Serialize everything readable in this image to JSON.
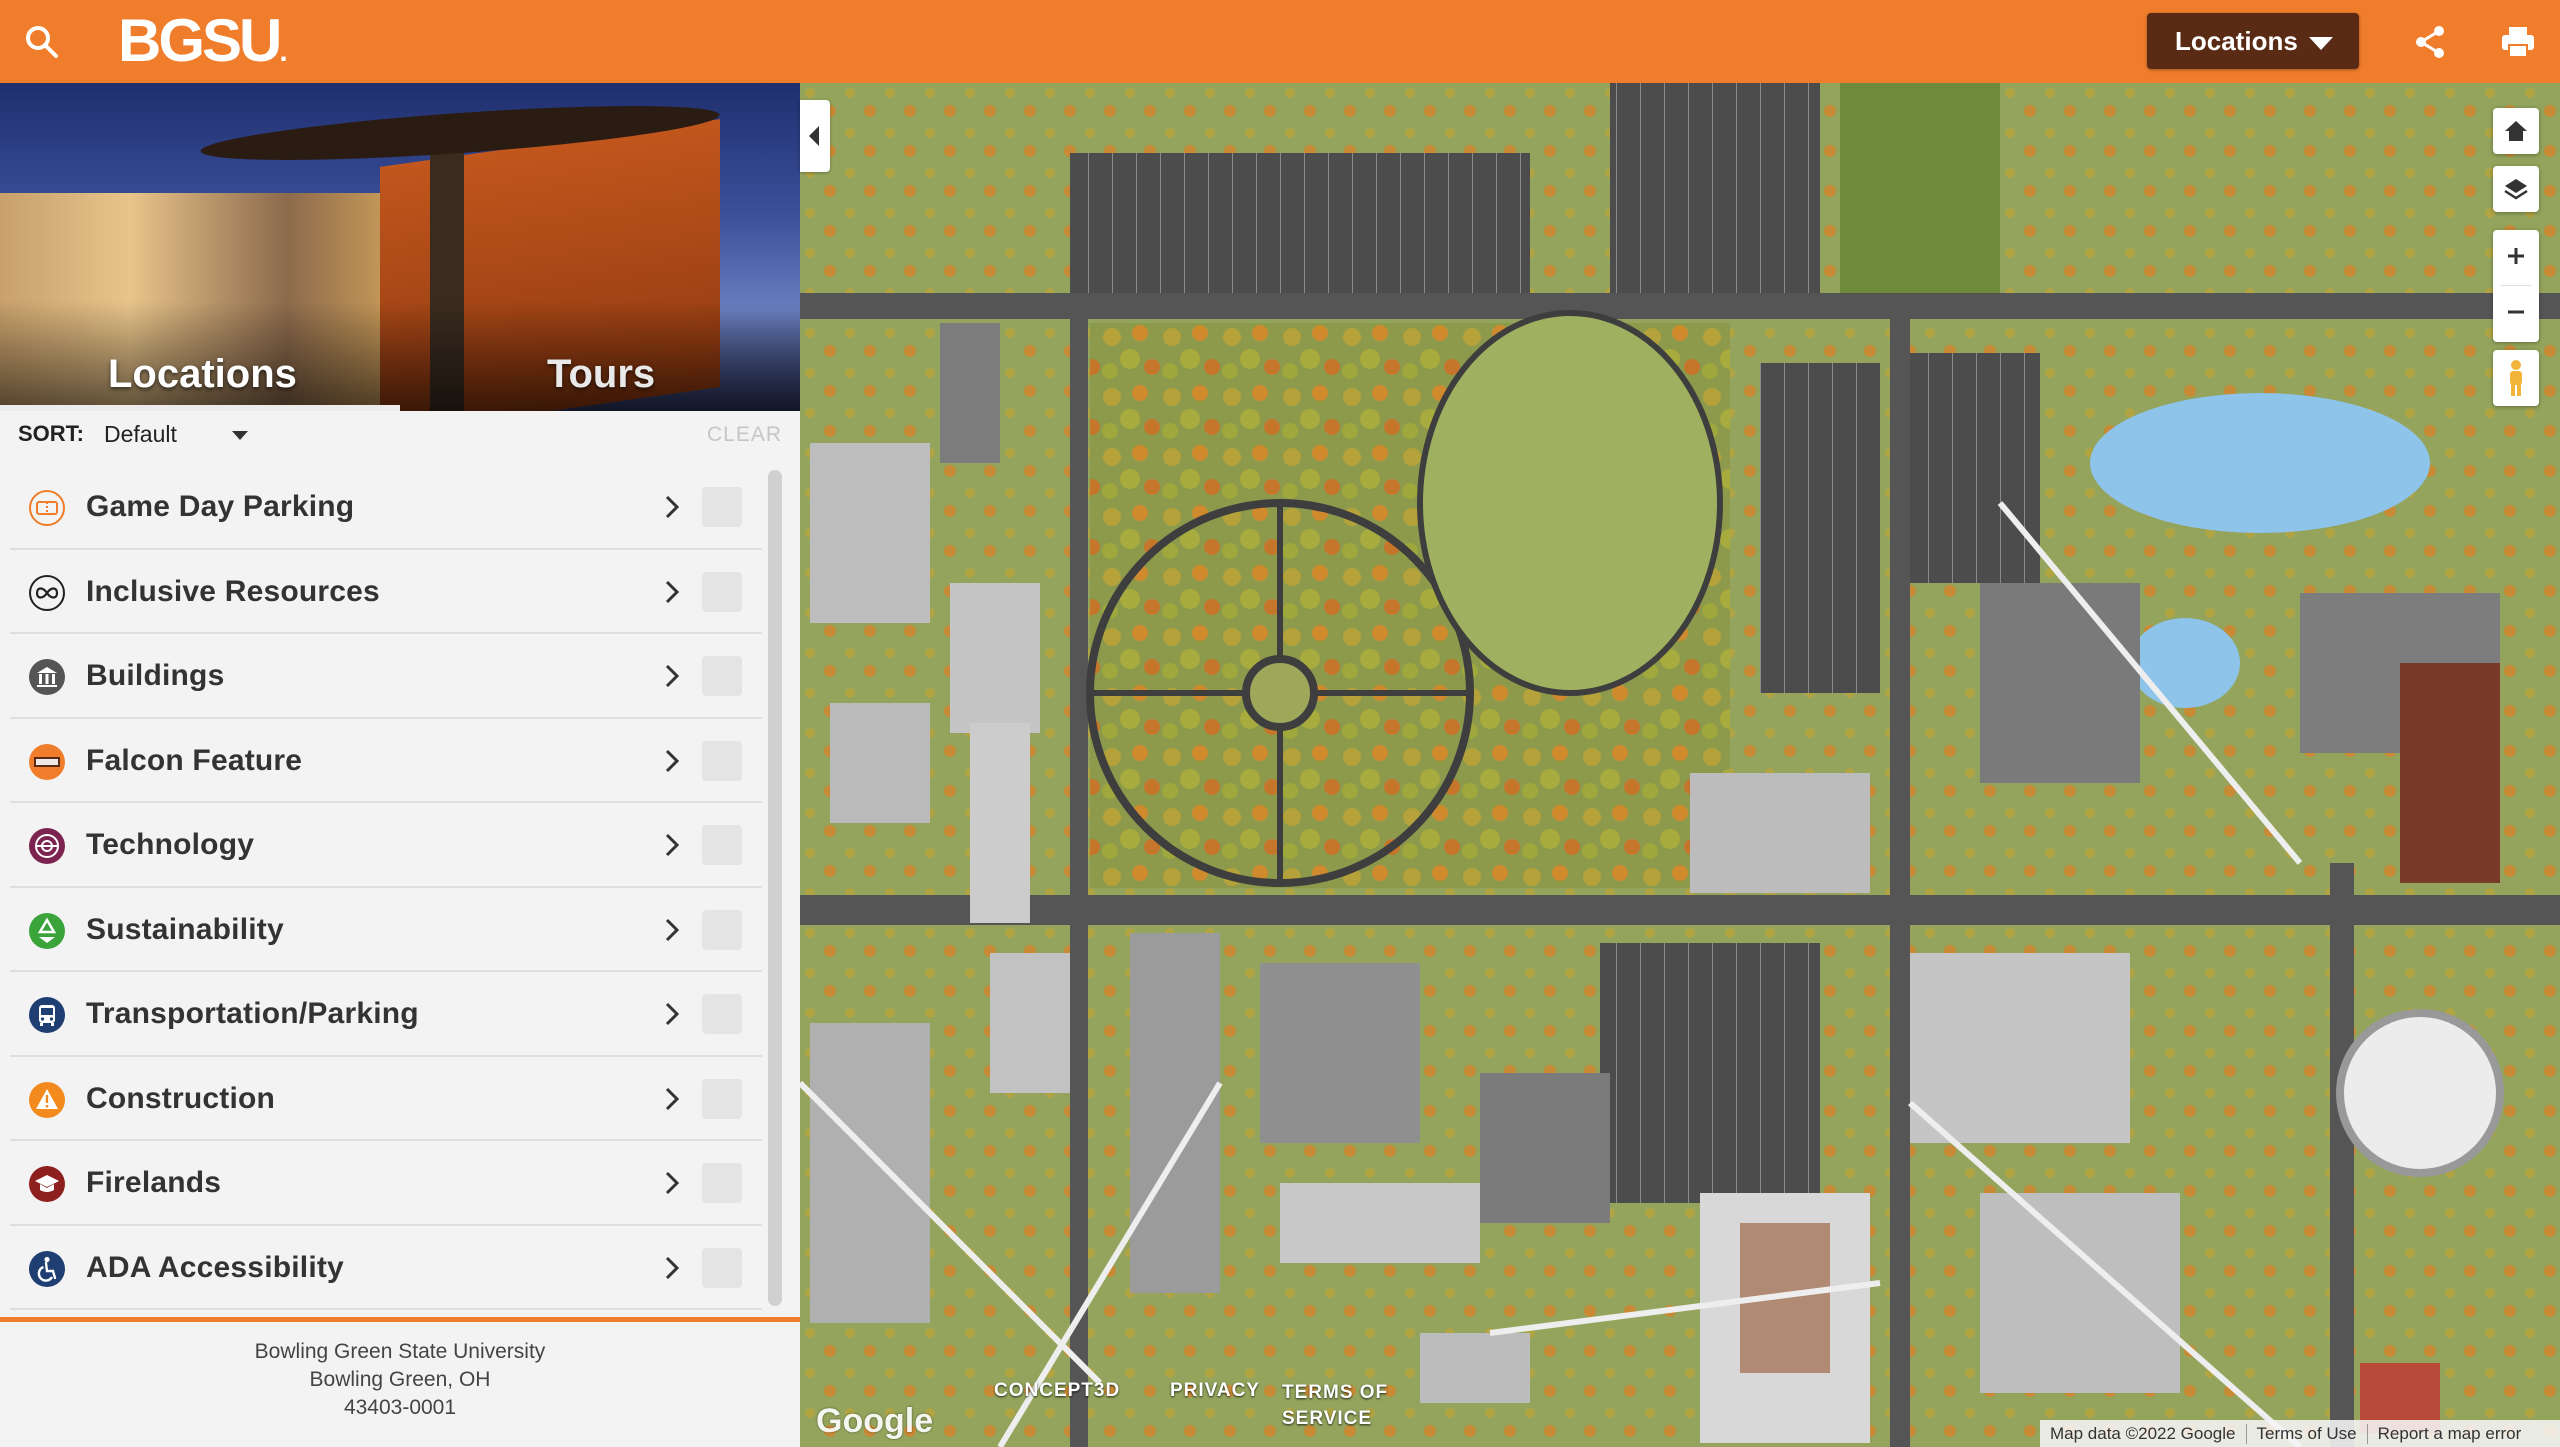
{
  "header": {
    "logo_text": "BGSU",
    "logo_dot": ".",
    "locations_button": "Locations",
    "brand_color": "#f07d2b",
    "button_color": "#5a2b14"
  },
  "hero": {
    "tabs": [
      {
        "label": "Locations",
        "active": true
      },
      {
        "label": "Tours",
        "active": false
      }
    ]
  },
  "sort": {
    "label": "SORT:",
    "value": "Default",
    "clear": "CLEAR"
  },
  "categories": [
    {
      "label": "Game Day Parking",
      "icon": "ticket-icon",
      "color": "#f07d2b"
    },
    {
      "label": "Inclusive Resources",
      "icon": "infinity-icon",
      "color": "#222222"
    },
    {
      "label": "Buildings",
      "icon": "building-icon",
      "color": "#555555"
    },
    {
      "label": "Falcon Feature",
      "icon": "bgsu-badge-icon",
      "color": "#f07d2b"
    },
    {
      "label": "Technology",
      "icon": "technology-icon",
      "color": "#7d2350"
    },
    {
      "label": "Sustainability",
      "icon": "recycle-icon",
      "color": "#3aa43a"
    },
    {
      "label": "Transportation/Parking",
      "icon": "bus-icon",
      "color": "#1f3e72"
    },
    {
      "label": "Construction",
      "icon": "warning-icon",
      "color": "#f28a1d"
    },
    {
      "label": "Firelands",
      "icon": "graduation-cap-icon",
      "color": "#8e1f1f"
    },
    {
      "label": "ADA Accessibility",
      "icon": "wheelchair-icon",
      "color": "#1f3e72"
    }
  ],
  "footer": {
    "line1": "Bowling Green State University",
    "line2": "Bowling Green, OH",
    "line3": "43403-0001"
  },
  "map": {
    "google_logo": "Google",
    "links": {
      "concept3d": "CONCEPT3D",
      "privacy": "PRIVACY",
      "terms_1": "TERMS OF",
      "terms_2": "SERVICE"
    },
    "attribution": [
      "Map data ©2022 Google",
      "Terms of Use",
      "Report a map error"
    ]
  }
}
